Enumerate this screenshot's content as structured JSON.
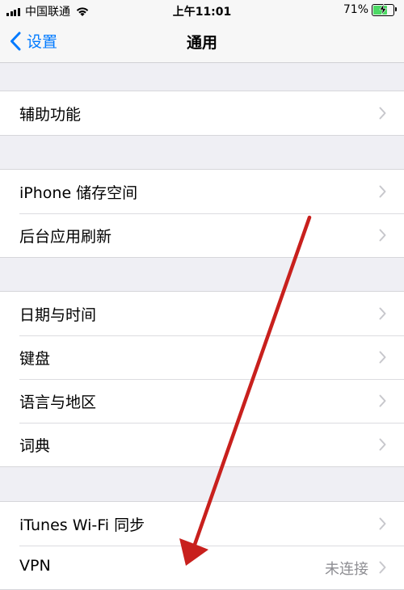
{
  "status_bar": {
    "carrier": "中国联通",
    "time": "上午11:01",
    "battery_percent": "71%",
    "battery_level": 0.71,
    "battery_color": "#4cd964"
  },
  "nav": {
    "back_label": "设置",
    "title": "通用",
    "accent_color": "#007aff"
  },
  "groups": [
    {
      "rows": [
        {
          "label": "辅助功能"
        }
      ]
    },
    {
      "rows": [
        {
          "label": "iPhone 储存空间"
        },
        {
          "label": "后台应用刷新"
        }
      ]
    },
    {
      "rows": [
        {
          "label": "日期与时间"
        },
        {
          "label": "键盘"
        },
        {
          "label": "语言与地区"
        },
        {
          "label": "词典"
        }
      ]
    },
    {
      "rows": [
        {
          "label": "iTunes Wi-Fi 同步"
        },
        {
          "label": "VPN",
          "value": "未连接"
        }
      ]
    }
  ],
  "icons": {
    "back": "chevron-left-icon",
    "row_disclosure": "chevron-right-icon",
    "wifi": "wifi-icon",
    "battery": "battery-icon",
    "charging": "bolt-icon"
  },
  "annotation": {
    "color": "#c8201d",
    "description_type": "red-arrow"
  }
}
